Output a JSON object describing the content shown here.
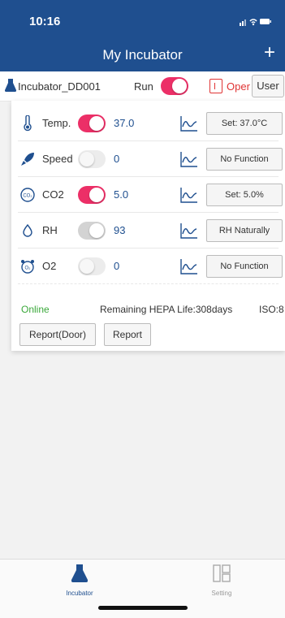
{
  "status": {
    "time": "10:16",
    "icons": "signal-bars wifi battery"
  },
  "nav": {
    "title": "My Incubator",
    "add": "+"
  },
  "device": {
    "name": "Incubator_DD001",
    "run_label": "Run",
    "run_on": true,
    "oper_label": "Oper",
    "user_button": "User"
  },
  "params": [
    {
      "icon": "thermometer-icon",
      "label": "Temp.",
      "toggle": "on",
      "value": "37.0",
      "button": "Set: 37.0°C"
    },
    {
      "icon": "rocket-icon",
      "label": "Speed",
      "toggle": "off",
      "value": "0",
      "button": "No Function"
    },
    {
      "icon": "co2-icon",
      "label": "CO2",
      "toggle": "on",
      "value": "5.0",
      "button": "Set: 5.0%"
    },
    {
      "icon": "drop-icon",
      "label": "RH",
      "toggle": "gray",
      "value": "93",
      "button": "RH Naturally"
    },
    {
      "icon": "o2-icon",
      "label": "O2",
      "toggle": "off",
      "value": "0",
      "button": "No Function"
    }
  ],
  "footer": {
    "status": "Online",
    "hepa": "Remaining HEPA Life:308days",
    "iso": "ISO:8",
    "report_door": "Report(Door)",
    "report": "Report"
  },
  "tabs": [
    {
      "label": "Incubator",
      "icon": "flask-icon",
      "active": true
    },
    {
      "label": "Setting",
      "icon": "grid-icon",
      "active": false
    }
  ],
  "colors": {
    "primary": "#1f4f8f",
    "toggle_on": "#ec2f67",
    "online": "#3aa83a",
    "oper": "#e03434"
  }
}
